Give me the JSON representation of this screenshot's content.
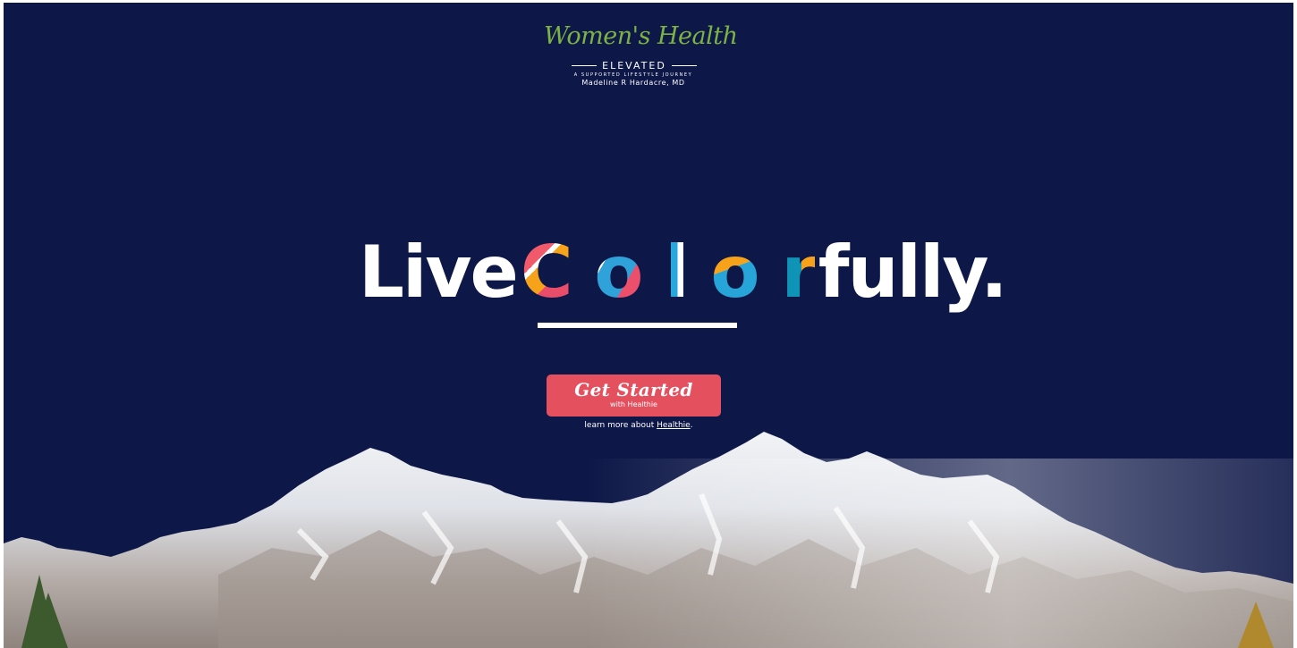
{
  "logo": {
    "script_text": "Women's Health",
    "elevated_text": "ELEVATED",
    "tagline": "A SUPPORTED LIFESTYLE JOURNEY",
    "author": "Madeline R Hardacre, MD"
  },
  "headline": {
    "word1": "Live",
    "color_letters": [
      "C",
      "o",
      "l",
      "o",
      "r"
    ],
    "rest": "fully."
  },
  "cta": {
    "main_label": "Get Started",
    "sub_label": "with Healthie"
  },
  "learn_more": {
    "prefix": "learn more about ",
    "link_text": "Healthie",
    "suffix": "."
  },
  "colors": {
    "background": "#0e1848",
    "logo_green": "#7cb342",
    "cta_red": "#e5505f",
    "accent_blue": "#28a5d8",
    "accent_orange": "#f7a21b",
    "accent_pink": "#f05a6a"
  }
}
